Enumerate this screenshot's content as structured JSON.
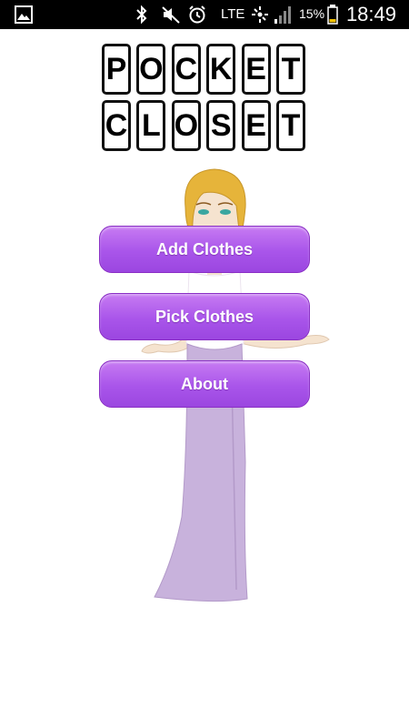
{
  "status_bar": {
    "network_label": "LTE",
    "battery_percent": "15%",
    "time": "18:49",
    "icons": [
      "gallery-icon",
      "bluetooth-icon",
      "mute-icon",
      "alarm-icon",
      "lte-icon",
      "data-activity-icon",
      "signal-icon",
      "battery-icon"
    ]
  },
  "logo": {
    "row1": [
      "P",
      "O",
      "C",
      "K",
      "E",
      "T"
    ],
    "row2": [
      "C",
      "L",
      "O",
      "S",
      "E",
      "T"
    ]
  },
  "menu": {
    "add_clothes": "Add Clothes",
    "pick_clothes": "Pick Clothes",
    "about": "About"
  },
  "colors": {
    "button_top": "#c77bf2",
    "button_bottom": "#9b46e0",
    "dress": "#c8b2dc",
    "hair": "#e6b43a"
  }
}
